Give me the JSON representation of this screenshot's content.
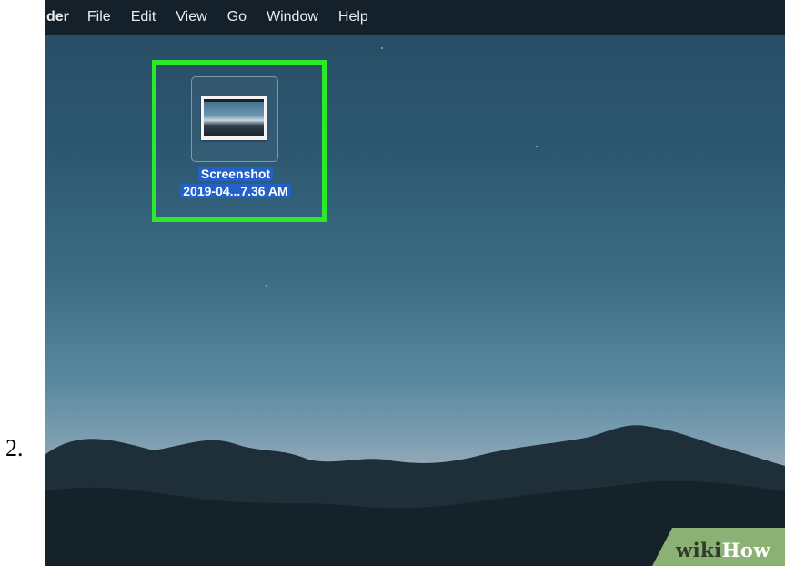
{
  "step": {
    "number": "2."
  },
  "menubar": {
    "app_name": "der",
    "items": [
      "File",
      "Edit",
      "View",
      "Go",
      "Window",
      "Help"
    ]
  },
  "desktop": {
    "file": {
      "icon": "image-file-icon",
      "name_line1": "Screenshot",
      "name_line2": "2019-04...7.36 AM",
      "selected": true
    },
    "highlight_color": "#2bea2b",
    "selection_color": "#2361c8"
  },
  "watermark": {
    "wiki": "wiki",
    "how": "How",
    "badge_color": "#8bb174"
  }
}
